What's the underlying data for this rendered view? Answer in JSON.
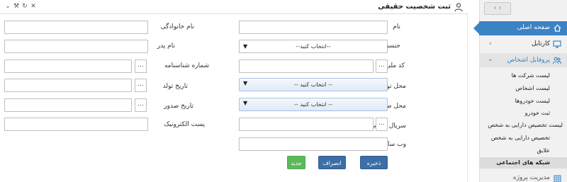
{
  "panel": {
    "title": "ثبت شخصیت حقیقی",
    "toolbar": {
      "collapse_glyph": "⌄",
      "settings_glyph": "⚒",
      "refresh_glyph": "↻",
      "close_glyph": "✕"
    }
  },
  "form": {
    "labels": {
      "first_name": "نام",
      "last_name": "نام خانوادگی",
      "gender": "جنسیت",
      "father_name": "نام پدر",
      "national_code": "کد ملی",
      "id_number": "شماره شناسنامه",
      "birth_place": "محل تولد",
      "birth_date": "تاریخ تولد",
      "issue_place": "محل صدور",
      "issue_date": "تاریخ صدور",
      "id_serial": "سریال شناسنامه",
      "email": "پست الکترونیک",
      "website": "وب سایت"
    },
    "values": {
      "first_name": "",
      "last_name": "",
      "father_name": "",
      "national_code": "",
      "id_number": "",
      "birth_date": "",
      "issue_date": "",
      "id_serial": "",
      "email": "",
      "website": ""
    },
    "gender_select": "--انتخاب کنید--",
    "birth_place_select": "-- انتخاب کنید --",
    "issue_place_select": "-- انتخاب کنید --",
    "ellipsis": "...",
    "buttons": {
      "save": "ذخیره",
      "cancel": "انصراف",
      "new": "جدید"
    }
  },
  "sidebar": {
    "nav_arrows": "‹ ›",
    "home": "صفحه اصلی",
    "items": [
      {
        "label": "کارتابل",
        "icon": "monitor-icon"
      },
      {
        "label": "پروفایل اشخاص",
        "icon": "users-icon"
      }
    ],
    "subitems": [
      "لیست شرکت ها",
      "لیست اشخاص",
      "لیست خودروها",
      "ثبت خودرو",
      "لیست تخصیص دارایی به شخص",
      "تخصیص دارایی به شخص",
      "علایق",
      "شبکه های اجتماعی"
    ],
    "bottom_item": "مدیریت پروژه",
    "colors": {
      "accent": "#3b83c3",
      "active_bg": "#dcdcdc"
    }
  }
}
